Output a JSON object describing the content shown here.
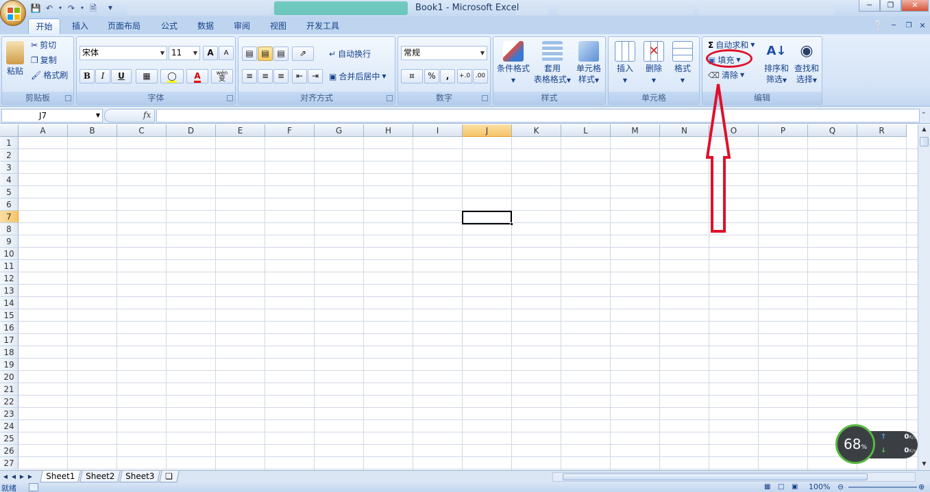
{
  "window": {
    "title": "Book1 - Microsoft Excel"
  },
  "ribbon_tabs": [
    "开始",
    "插入",
    "页面布局",
    "公式",
    "数据",
    "审阅",
    "视图",
    "开发工具"
  ],
  "clipboard": {
    "paste": "粘贴",
    "cut": "剪切",
    "copy": "复制",
    "format_painter": "格式刷",
    "label": "剪贴板"
  },
  "font": {
    "name": "宋体",
    "size": "11",
    "bold": "B",
    "italic": "I",
    "underline": "U",
    "grow": "A",
    "shrink": "A",
    "label": "字体",
    "wen": "wén",
    "wen2": "变"
  },
  "alignment": {
    "wrap": "自动换行",
    "merge": "合并后居中",
    "label": "对齐方式"
  },
  "number": {
    "format": "常规",
    "percent": "%",
    "comma": ",",
    "label": "数字"
  },
  "styles": {
    "conditional": "条件格式",
    "table_line1": "套用",
    "table_line2": "表格格式",
    "cell_line1": "单元格",
    "cell_line2": "样式",
    "label": "样式"
  },
  "cells": {
    "insert": "插入",
    "delete": "删除",
    "format": "格式",
    "label": "单元格"
  },
  "editing": {
    "autosum": "自动求和",
    "fill": "填充",
    "clear": "清除",
    "sort_line1": "排序和",
    "sort_line2": "筛选",
    "find_line1": "查找和",
    "find_line2": "选择",
    "label": "编辑"
  },
  "formula_bar": {
    "name_box": "J7",
    "fx": "fx",
    "value": ""
  },
  "columns": [
    "A",
    "B",
    "C",
    "D",
    "E",
    "F",
    "G",
    "H",
    "I",
    "J",
    "K",
    "L",
    "M",
    "N",
    "O",
    "P",
    "Q",
    "R"
  ],
  "rows": [
    "1",
    "2",
    "3",
    "4",
    "5",
    "6",
    "7",
    "8",
    "9",
    "10",
    "11",
    "12",
    "13",
    "14",
    "15",
    "16",
    "17",
    "18",
    "19",
    "20",
    "21",
    "22",
    "23",
    "24",
    "25",
    "26",
    "27"
  ],
  "selected_cell": {
    "column": "J",
    "row": "7"
  },
  "sheets": [
    "Sheet1",
    "Sheet2",
    "Sheet3"
  ],
  "active_sheet": "Sheet1",
  "status": {
    "ready": "就绪",
    "zoom": "100%"
  },
  "net_widget": {
    "percent": "68",
    "percent_sign": "%",
    "up": "0",
    "down": "0",
    "unit": "K/s"
  },
  "colors": {
    "accent": "#15428b",
    "annotation": "#e0102a",
    "selected_header": "#f6c46a"
  }
}
